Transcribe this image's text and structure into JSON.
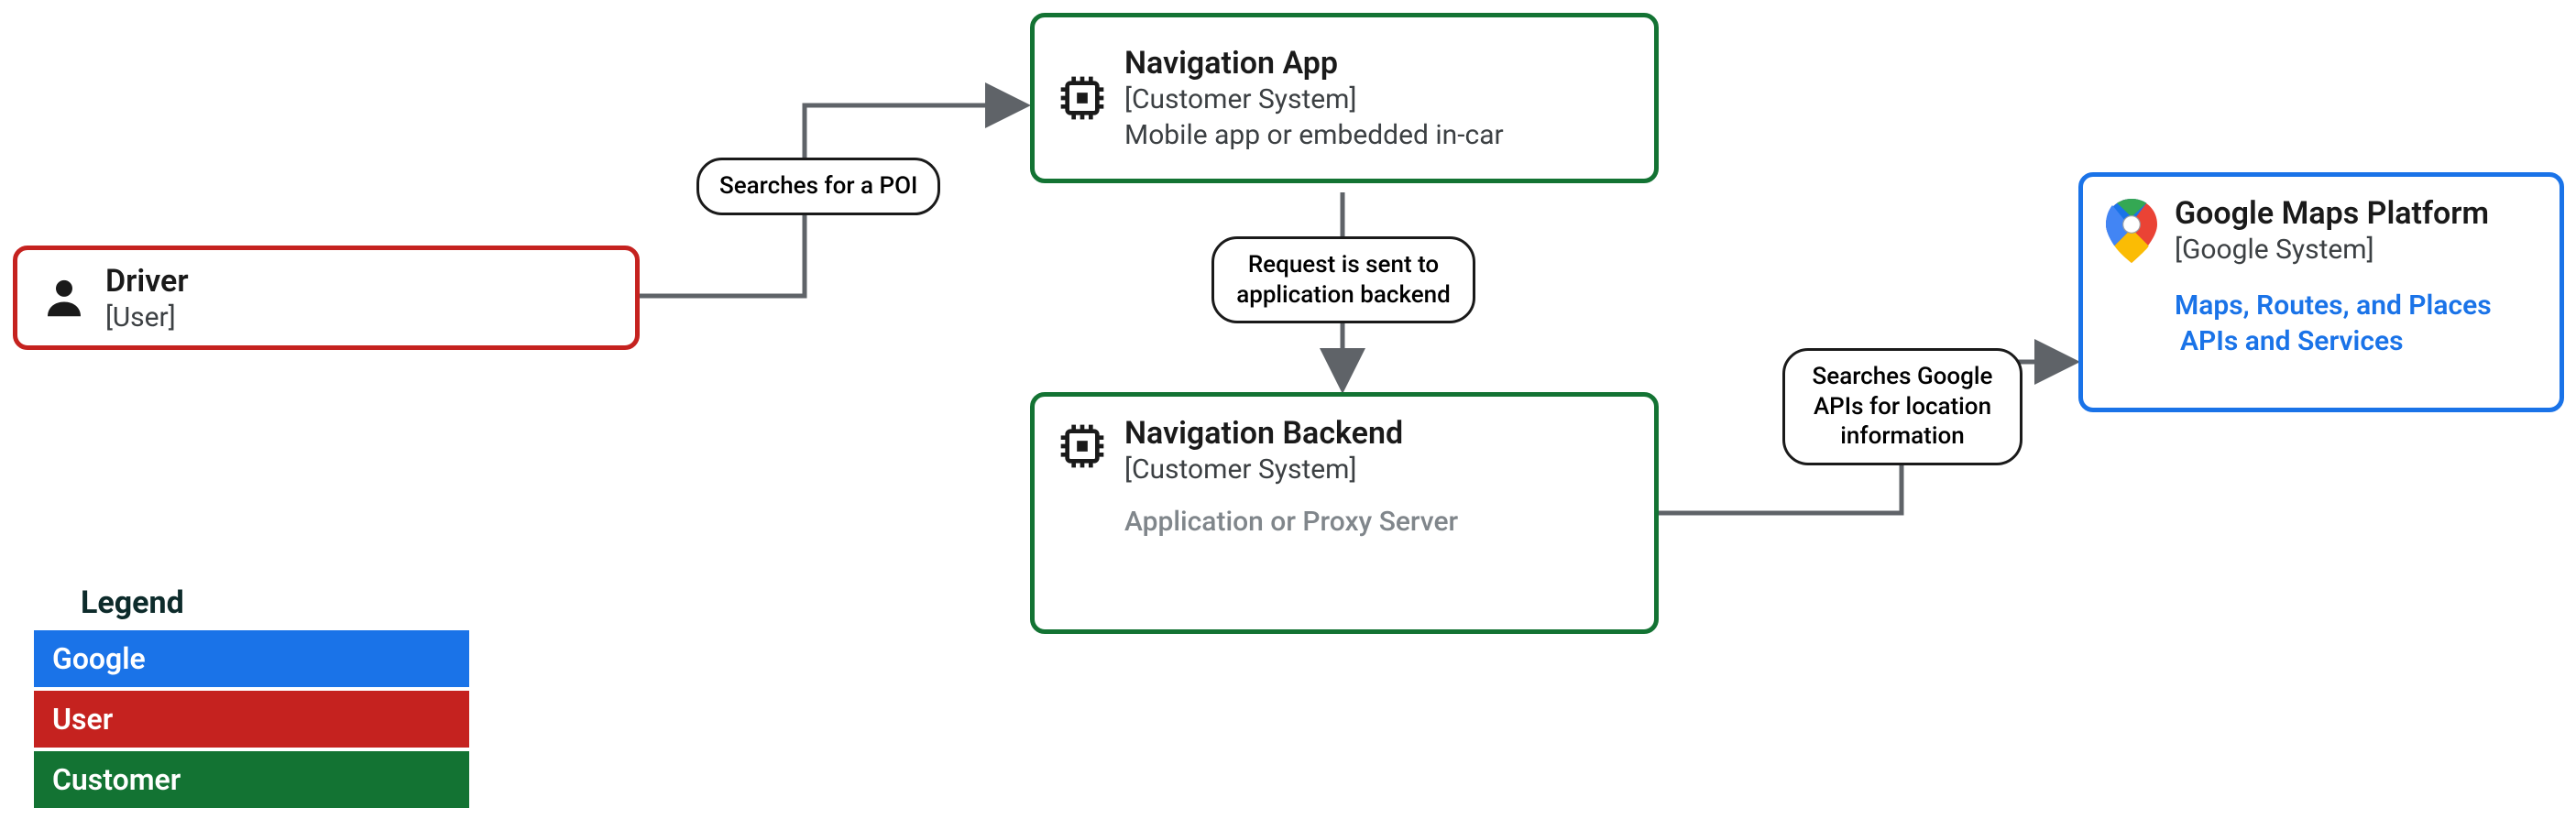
{
  "nodes": {
    "driver": {
      "title": "Driver",
      "subtitle": "[User]"
    },
    "navApp": {
      "title": "Navigation App",
      "subtitle": "[Customer System]",
      "desc": "Mobile app or embedded in-car"
    },
    "navBackend": {
      "title": "Navigation Backend",
      "subtitle": "[Customer System]",
      "extra": "Application or Proxy Server"
    },
    "gmp": {
      "title": "Google Maps Platform",
      "subtitle": "[Google System]",
      "link1": "Maps, Routes, and Places",
      "link2": "APIs and Services"
    }
  },
  "edges": {
    "search": "Searches for a POI",
    "request": "Request is sent to application backend",
    "api": "Searches Google APIs for location information"
  },
  "legend": {
    "title": "Legend",
    "google": "Google",
    "user": "User",
    "customer": "Customer"
  },
  "colors": {
    "google": "#1a73e8",
    "user": "#c5221f",
    "customer": "#137333"
  }
}
